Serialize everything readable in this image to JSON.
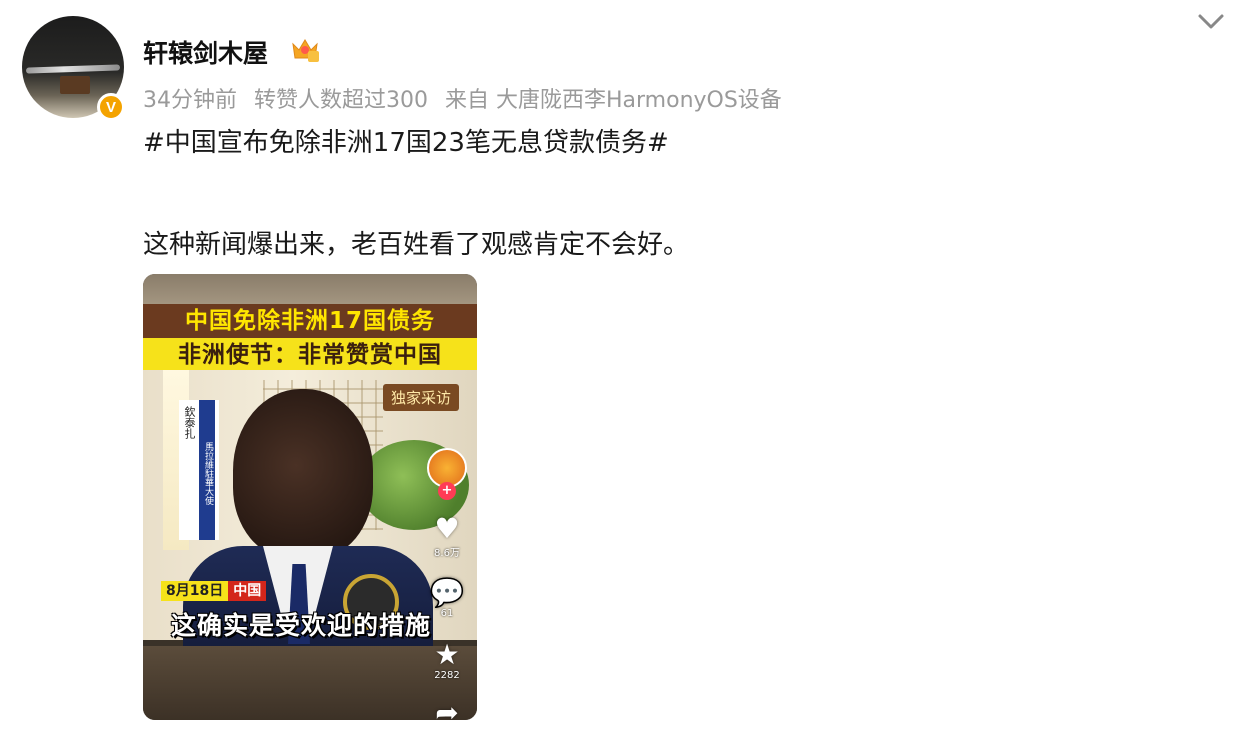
{
  "post": {
    "username": "轩辕剑木屋",
    "meta": {
      "time": "34分钟前",
      "reposts": "转赞人数超过300",
      "source": "来自 大唐陇西李HarmonyOS设备"
    },
    "hashtag": "#中国宣布免除非洲17国23笔无息贷款债务#",
    "text": "这种新闻爆出来，老百姓看了观感肯定不会好。"
  },
  "video": {
    "title_line1": "中国免除非洲17国债务",
    "title_line2": "非洲使节：非常赞赏中国",
    "exclusive": "独家采访",
    "speaker_name": "欽泰扎",
    "speaker_title": "馬拉維駐華大使",
    "date": "8月18日",
    "channel": "中国",
    "caption": "这确实是受欢迎的措施",
    "likes": "8.6万",
    "comments": "61",
    "favorites": "2282"
  },
  "colors": {
    "vip_badge": "#f4a300",
    "title_bar": "#f6e21a",
    "title_band": "#6b3a1f",
    "follow_plus": "#ff3b55"
  }
}
